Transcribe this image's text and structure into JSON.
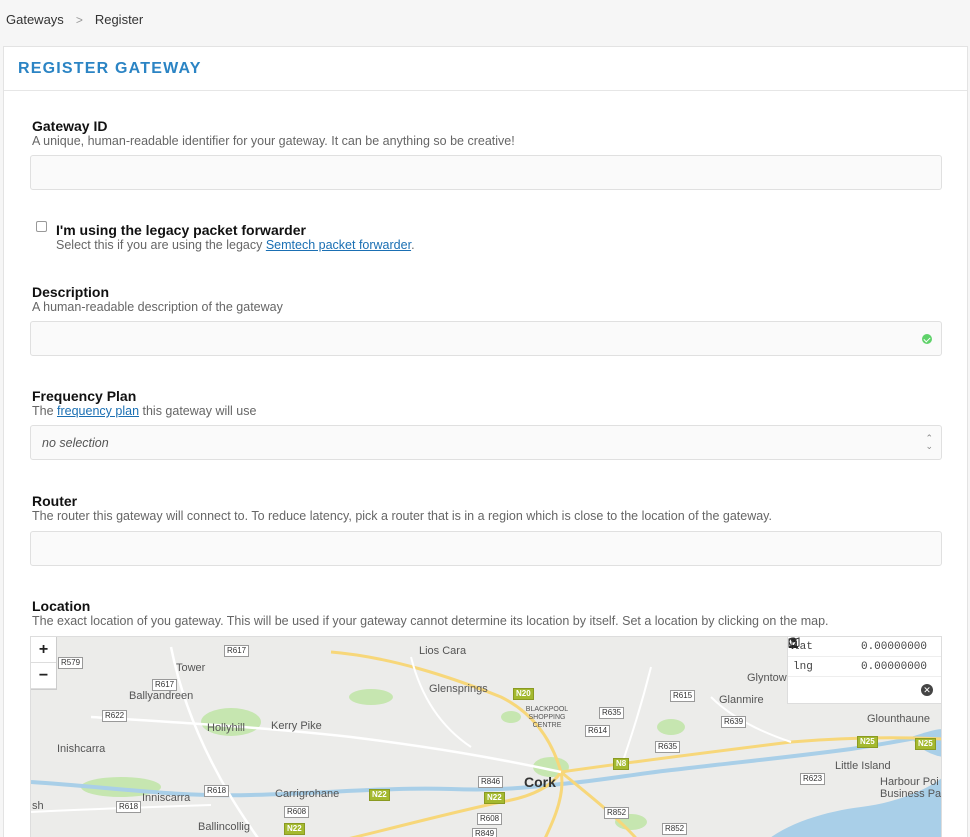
{
  "breadcrumb": {
    "items": [
      "Gateways",
      "Register"
    ],
    "sep": ">"
  },
  "panel": {
    "title": "REGISTER GATEWAY"
  },
  "gateway_id": {
    "label": "Gateway ID",
    "help": "A unique, human-readable identifier for your gateway. It can be anything so be creative!",
    "value": ""
  },
  "legacy": {
    "label": "I'm using the legacy packet forwarder",
    "help_prefix": "Select this if you are using the legacy ",
    "link": "Semtech packet forwarder",
    "help_suffix": "."
  },
  "description": {
    "label": "Description",
    "help": "A human-readable description of the gateway",
    "value": ""
  },
  "frequency": {
    "label": "Frequency Plan",
    "help_prefix": "The ",
    "link": "frequency plan",
    "help_suffix": " this gateway will use",
    "selected": "no selection"
  },
  "router": {
    "label": "Router",
    "help": "The router this gateway will connect to. To reduce latency, pick a router that is in a region which is close to the location of the gateway.",
    "value": ""
  },
  "location": {
    "label": "Location",
    "help": "The exact location of you gateway. This will be used if your gateway cannot determine its location by itself. Set a location by clicking on the map.",
    "zoom_in": "+",
    "zoom_out": "−",
    "lat_label": "lat",
    "lat_value": "0.00000000",
    "lng_label": "lng",
    "lng_value": "0.00000000",
    "tools": [
      "map-icon",
      "user-icon",
      "pin-icon",
      "close-icon"
    ],
    "places": {
      "lios_cara": "Lios Cara",
      "tower": "Tower",
      "ballyandreen": "Ballyandreen",
      "glensprings": "Glensprings",
      "glanmire": "Glanmire",
      "glyntown": "Glyntow",
      "glounthaune": "Glounthaune",
      "hollyhill": "Hollyhill",
      "kerry_pike": "Kerry Pike",
      "inishcarra": "Inishcarra",
      "blackpool": "BLACKPOOL SHOPPING CENTRE",
      "cork": "Cork",
      "little_island": "Little Island",
      "harbour": "Harbour Poi",
      "business": "Business Pa",
      "inniscarra": "Inniscarra",
      "carrigrohane": "Carrigrohane",
      "ballincollig": "Ballincollig",
      "sh": "sh"
    },
    "roads": {
      "r579": "R579",
      "r617a": "R617",
      "r617b": "R617",
      "r622": "R622",
      "n20": "N20",
      "r635a": "R635",
      "r614": "R614",
      "r615": "R615",
      "r639": "R639",
      "r635b": "R635",
      "n8": "N8",
      "n25a": "N25",
      "n25b": "N25",
      "r623": "R623",
      "r846": "R846",
      "r618a": "R618",
      "r618b": "R618",
      "n22a": "N22",
      "n22b": "N22",
      "n22c": "N22",
      "r608a": "R608",
      "r608b": "R608",
      "r852a": "R852",
      "r852b": "R852",
      "r849": "R849"
    }
  },
  "colors": {
    "accent": "#2b84c4",
    "link": "#1a6fb3",
    "valid": "#5fd26a",
    "water": "#a9cfe8",
    "park": "#c6e6b0",
    "national_road": "#a4b92f"
  }
}
